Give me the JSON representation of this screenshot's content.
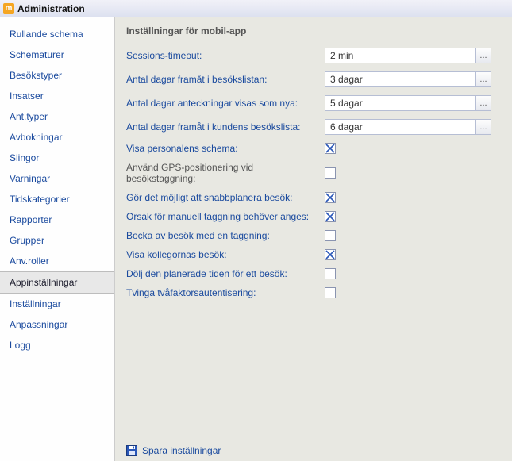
{
  "title": "Administration",
  "app_icon_glyph": "m",
  "sidebar": {
    "items": [
      {
        "label": "Rullande schema",
        "selected": false
      },
      {
        "label": "Schematurer",
        "selected": false
      },
      {
        "label": "Besökstyper",
        "selected": false
      },
      {
        "label": "Insatser",
        "selected": false
      },
      {
        "label": "Ant.typer",
        "selected": false
      },
      {
        "label": "Avbokningar",
        "selected": false
      },
      {
        "label": "Slingor",
        "selected": false
      },
      {
        "label": "Varningar",
        "selected": false
      },
      {
        "label": "Tidskategorier",
        "selected": false
      },
      {
        "label": "Rapporter",
        "selected": false
      },
      {
        "label": "Grupper",
        "selected": false
      },
      {
        "label": "Anv.roller",
        "selected": false
      },
      {
        "label": "Appinställningar",
        "selected": true
      },
      {
        "label": "Inställningar",
        "selected": false
      },
      {
        "label": "Anpassningar",
        "selected": false
      },
      {
        "label": "Logg",
        "selected": false
      }
    ]
  },
  "main": {
    "section_title": "Inställningar för mobil-app",
    "dropdown_glyph": "...",
    "combos": [
      {
        "label": "Sessions-timeout:",
        "value": "2 min"
      },
      {
        "label": "Antal dagar framåt i besökslistan:",
        "value": "3 dagar"
      },
      {
        "label": "Antal dagar anteckningar visas som nya:",
        "value": "5 dagar"
      },
      {
        "label": "Antal dagar framåt i kundens besökslista:",
        "value": "6 dagar"
      }
    ],
    "checks": [
      {
        "label": "Visa personalens schema:",
        "checked": true
      },
      {
        "label": "Använd GPS-positionering vid besökstaggning:",
        "checked": false,
        "grey": true
      },
      {
        "label": "Gör det möjligt att snabbplanera besök:",
        "checked": true
      },
      {
        "label": "Orsak för manuell taggning behöver anges:",
        "checked": true
      },
      {
        "label": "Bocka av besök med en taggning:",
        "checked": false
      },
      {
        "label": "Visa kollegornas besök:",
        "checked": true
      },
      {
        "label": "Dölj den planerade tiden för ett besök:",
        "checked": false
      },
      {
        "label": "Tvinga tvåfaktorsautentisering:",
        "checked": false
      }
    ],
    "save_label": "Spara inställningar"
  }
}
